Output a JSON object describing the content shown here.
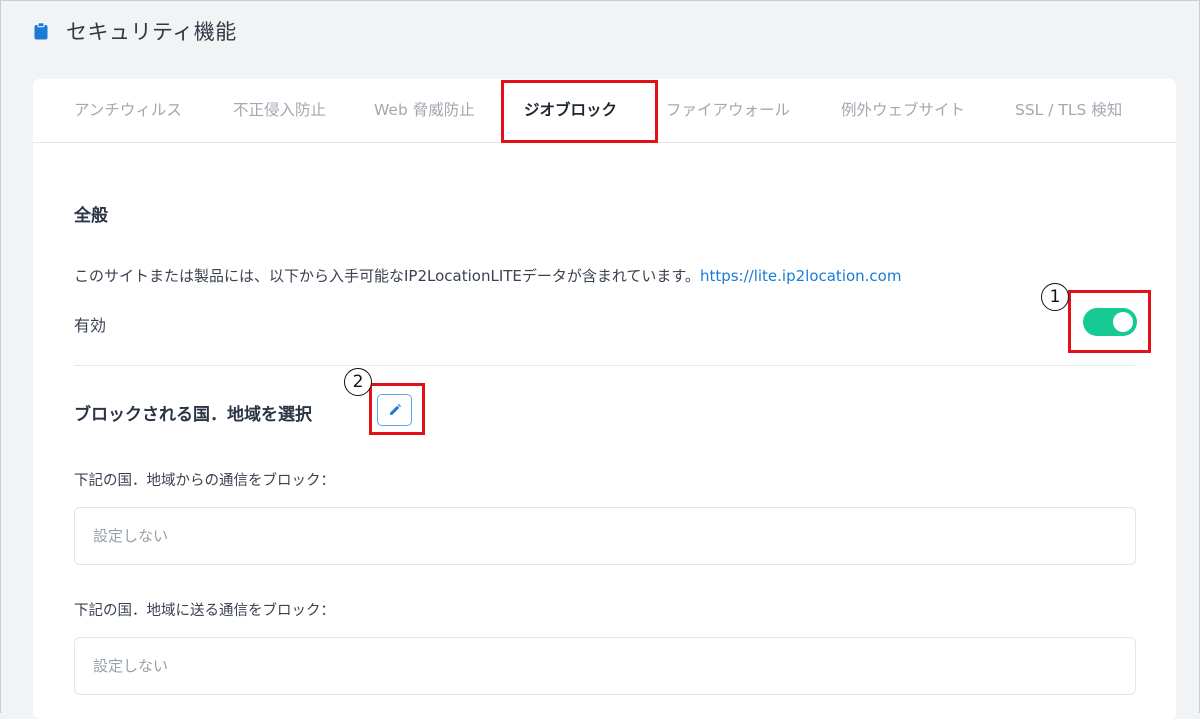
{
  "header": {
    "title": "セキュリティ機能",
    "icon": "clipboard-icon",
    "icon_color": "#1a7ad6"
  },
  "tabs": [
    {
      "label": "アンチウィルス",
      "active": false
    },
    {
      "label": "不正侵入防止",
      "active": false
    },
    {
      "label": "Web 脅威防止",
      "active": false
    },
    {
      "label": "ジオブロック",
      "active": true
    },
    {
      "label": "ファイアウォール",
      "active": false
    },
    {
      "label": "例外ウェブサイト",
      "active": false
    },
    {
      "label": "SSL / TLS 検知",
      "active": false
    }
  ],
  "general": {
    "title": "全般",
    "description": "このサイトまたは製品には、以下から入手可能なIP2LocationLITEデータが含まれています。",
    "link_text": "https://lite.ip2location.com",
    "enable_label": "有効",
    "enabled": true,
    "toggle_color": "#17c993"
  },
  "blocked": {
    "title": "ブロックされる国．地域を選択",
    "edit_icon": "pencil-icon",
    "inbound_label": "下記の国．地域からの通信をブロック：",
    "inbound_value": "設定しない",
    "outbound_label": "下記の国．地域に送る通信をブロック：",
    "outbound_value": "設定しない"
  },
  "annotations": {
    "marker_1": "1",
    "marker_2": "2",
    "highlight_color": "#e3101a"
  }
}
